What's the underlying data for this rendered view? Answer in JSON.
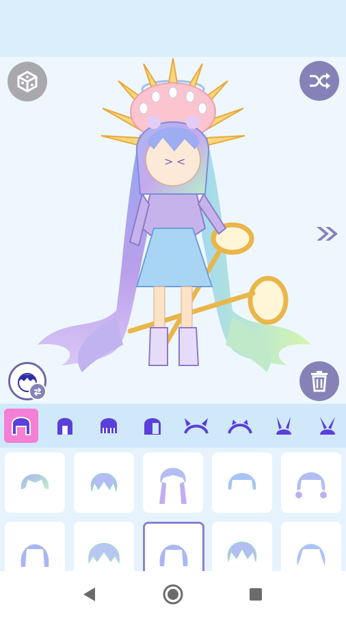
{
  "app": {
    "accent_color": "#8682b8",
    "selected_category_color": "#f47fd5",
    "category_icon_color": "#5b3fd9"
  },
  "toolbar": {
    "random_button_icon": "dice-icon",
    "shuffle_button_icon": "shuffle-icon",
    "next_button_icon": "double-chevron-right-icon",
    "delete_button_icon": "trash-icon",
    "avatar_button_icon": "face-swap-icon"
  },
  "categories": [
    {
      "icon": "full-hair-icon",
      "selected": true
    },
    {
      "icon": "front-hair-icon",
      "selected": false
    },
    {
      "icon": "bangs-icon",
      "selected": false
    },
    {
      "icon": "side-hair-icon",
      "selected": false
    },
    {
      "icon": "horn-headband-icon",
      "selected": false
    },
    {
      "icon": "cat-ear-headband-icon",
      "selected": false
    },
    {
      "icon": "bunny-ears-icon",
      "selected": false
    },
    {
      "icon": "bunny-ears-alt-icon",
      "selected": false
    }
  ],
  "hair_items": [
    {
      "id": "hair-1",
      "selected": false
    },
    {
      "id": "hair-2",
      "selected": false
    },
    {
      "id": "hair-3",
      "selected": false
    },
    {
      "id": "hair-4",
      "selected": false
    },
    {
      "id": "hair-5",
      "selected": false
    },
    {
      "id": "hair-6",
      "selected": false
    },
    {
      "id": "hair-7",
      "selected": false
    },
    {
      "id": "hair-8",
      "selected": true
    },
    {
      "id": "hair-9",
      "selected": false
    },
    {
      "id": "hair-10",
      "selected": false
    }
  ],
  "navigation": {
    "back_icon": "back-triangle-icon",
    "home_icon": "home-circle-icon",
    "recents_icon": "recents-square-icon"
  }
}
